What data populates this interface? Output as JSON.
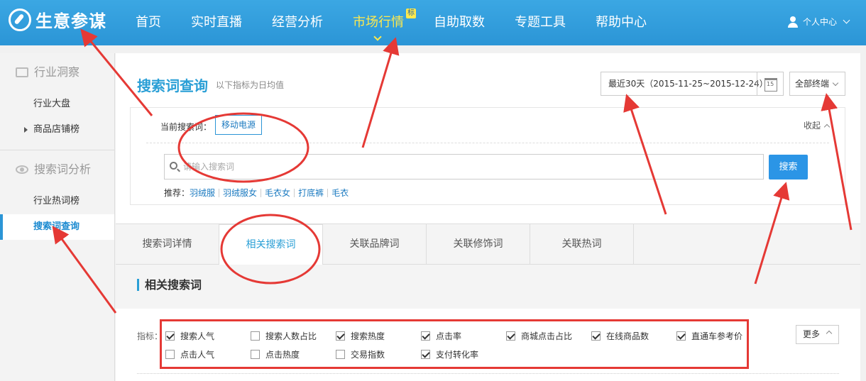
{
  "brand": {
    "name": "生意参谋"
  },
  "nav": {
    "items": [
      {
        "label": "首页"
      },
      {
        "label": "实时直播"
      },
      {
        "label": "经营分析"
      },
      {
        "label": "市场行情",
        "badge": "标"
      },
      {
        "label": "自助取数"
      },
      {
        "label": "专题工具"
      },
      {
        "label": "帮助中心"
      }
    ],
    "user_label": "个人中心"
  },
  "sidebar": {
    "sections": [
      {
        "title": "行业洞察",
        "items": [
          "行业大盘",
          "商品店铺榜"
        ]
      },
      {
        "title": "搜索词分析",
        "items": [
          "行业热词榜",
          "搜索词查询"
        ]
      }
    ],
    "active_item": "搜索词查询"
  },
  "page": {
    "title": "搜索词查询",
    "subtitle": "以下指标为日均值",
    "date_range": "最近30天（2015-11-25~2015-12-24）",
    "calendar_day": "15",
    "terminal": "全部终端"
  },
  "search": {
    "current_label": "当前搜索词：",
    "current_word": "移动电源",
    "collapse_label": "收起",
    "placeholder": "请输入搜索词",
    "button": "搜索",
    "recommend_label": "推荐：",
    "recommend": [
      "羽绒服",
      "羽绒服女",
      "毛衣女",
      "打底裤",
      "毛衣"
    ]
  },
  "tabs": [
    "搜索词详情",
    "相关搜索词",
    "关联品牌词",
    "关联修饰词",
    "关联热词"
  ],
  "section_title": "相关搜索词",
  "metrics": {
    "label": "指标：",
    "more": "更多",
    "items": [
      {
        "label": "搜索人气",
        "checked": true
      },
      {
        "label": "搜索人数占比",
        "checked": false
      },
      {
        "label": "搜索热度",
        "checked": true
      },
      {
        "label": "点击率",
        "checked": true
      },
      {
        "label": "商城点击占比",
        "checked": true
      },
      {
        "label": "在线商品数",
        "checked": true
      },
      {
        "label": "直通车参考价",
        "checked": true
      },
      {
        "label": "点击人气",
        "checked": false
      },
      {
        "label": "点击热度",
        "checked": false
      },
      {
        "label": "交易指数",
        "checked": false
      },
      {
        "label": "支付转化率",
        "checked": true
      }
    ]
  },
  "colors": {
    "nav_bg": "#2b95d6",
    "accent": "#2a9fd6",
    "active_nav": "#ffe94d",
    "annotation": "#e53935"
  }
}
